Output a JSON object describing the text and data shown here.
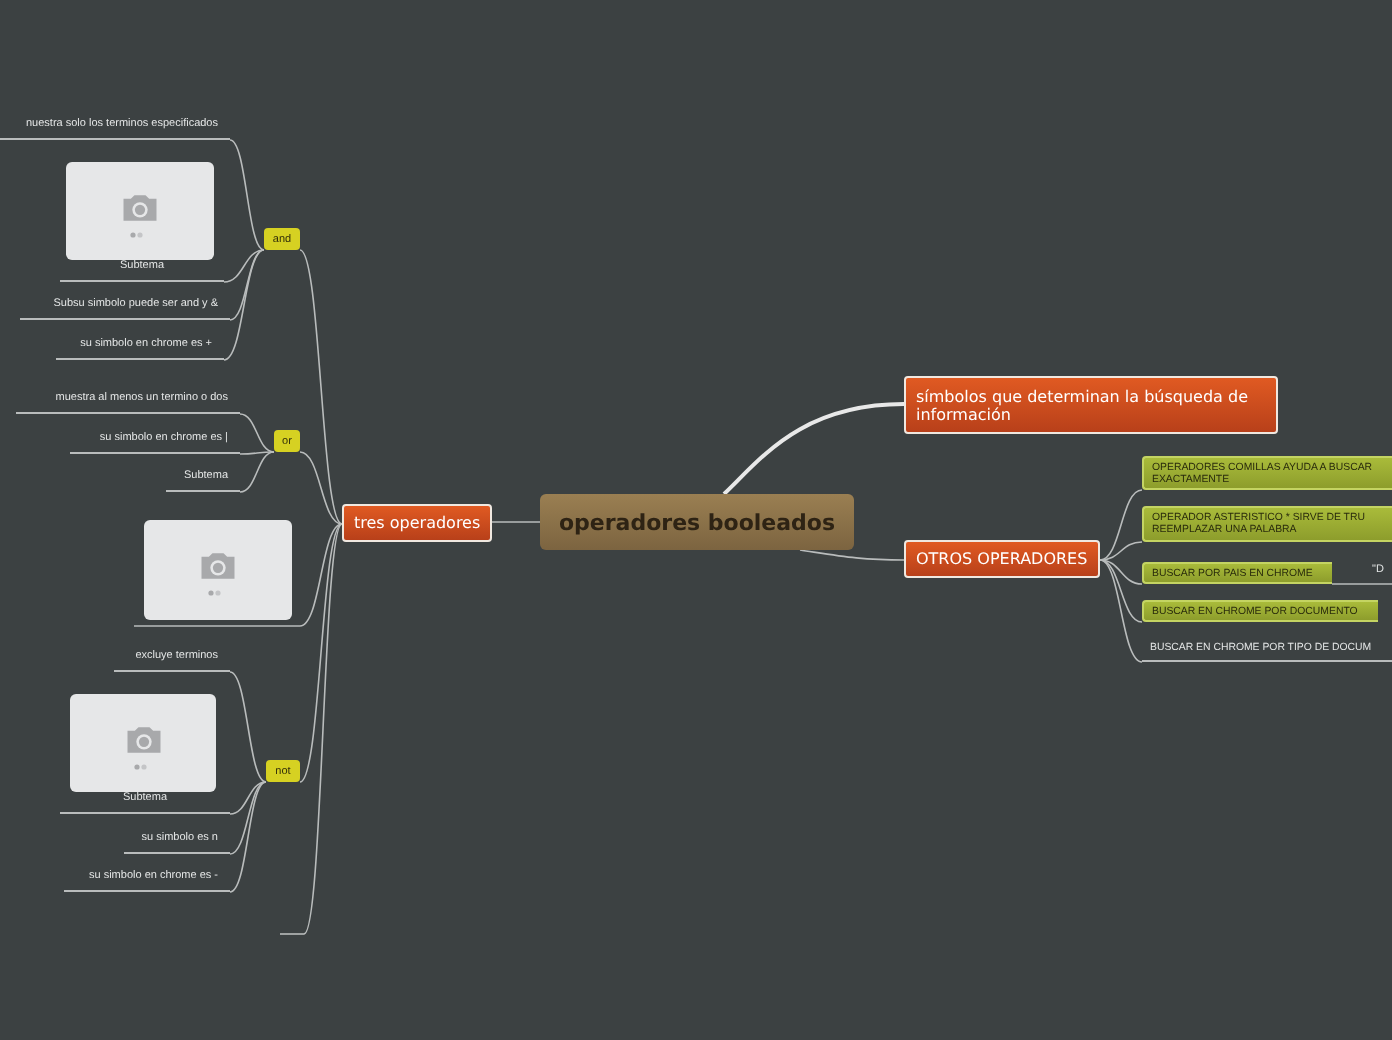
{
  "central_topic": {
    "label": "operadores booleados"
  },
  "left_branch": {
    "label": "tres operadores",
    "children": [
      {
        "kind": "group",
        "label": "and",
        "items": [
          {
            "kind": "text",
            "label": "nuestra solo los terminos especificados"
          },
          {
            "kind": "image",
            "caption": "Subtema"
          },
          {
            "kind": "text",
            "label": "Subsu simbolo puede ser and y &"
          },
          {
            "kind": "text",
            "label": "su simbolo en chrome es +"
          }
        ]
      },
      {
        "kind": "group",
        "label": "or",
        "items": [
          {
            "kind": "text",
            "label": "muestra al menos un termino o dos"
          },
          {
            "kind": "text",
            "label": "su simbolo en chrome es |"
          },
          {
            "kind": "text",
            "label": "Subtema"
          }
        ]
      },
      {
        "kind": "image"
      },
      {
        "kind": "group",
        "label": "not",
        "items": [
          {
            "kind": "text",
            "label": "excluye terminos"
          },
          {
            "kind": "image",
            "caption": "Subtema"
          },
          {
            "kind": "text",
            "label": "su simbolo es n"
          },
          {
            "kind": "text",
            "label": "su simbolo en chrome es -"
          }
        ]
      }
    ]
  },
  "right_branches": [
    {
      "label": "símbolos que determinan la búsqueda de información"
    },
    {
      "label": "OTROS OPERADORES",
      "children": [
        {
          "kind": "tag",
          "lines": [
            "OPERADORES COMILLAS AYUDA A BUSCAR",
            "EXACTAMENTE"
          ]
        },
        {
          "kind": "tag",
          "lines": [
            "OPERADOR ASTERISTICO * SIRVE DE TRU",
            "REEMPLAZAR UNA PALABRA"
          ]
        },
        {
          "kind": "tag",
          "lines": [
            "BUSCAR POR PAIS EN CHROME"
          ],
          "detail": "\"D"
        },
        {
          "kind": "tag",
          "lines": [
            "BUSCAR EN CHROME POR DOCUMENTO"
          ]
        },
        {
          "kind": "text",
          "lines": [
            "BUSCAR EN CHROME POR TIPO DE DOCUM"
          ]
        }
      ]
    }
  ]
}
